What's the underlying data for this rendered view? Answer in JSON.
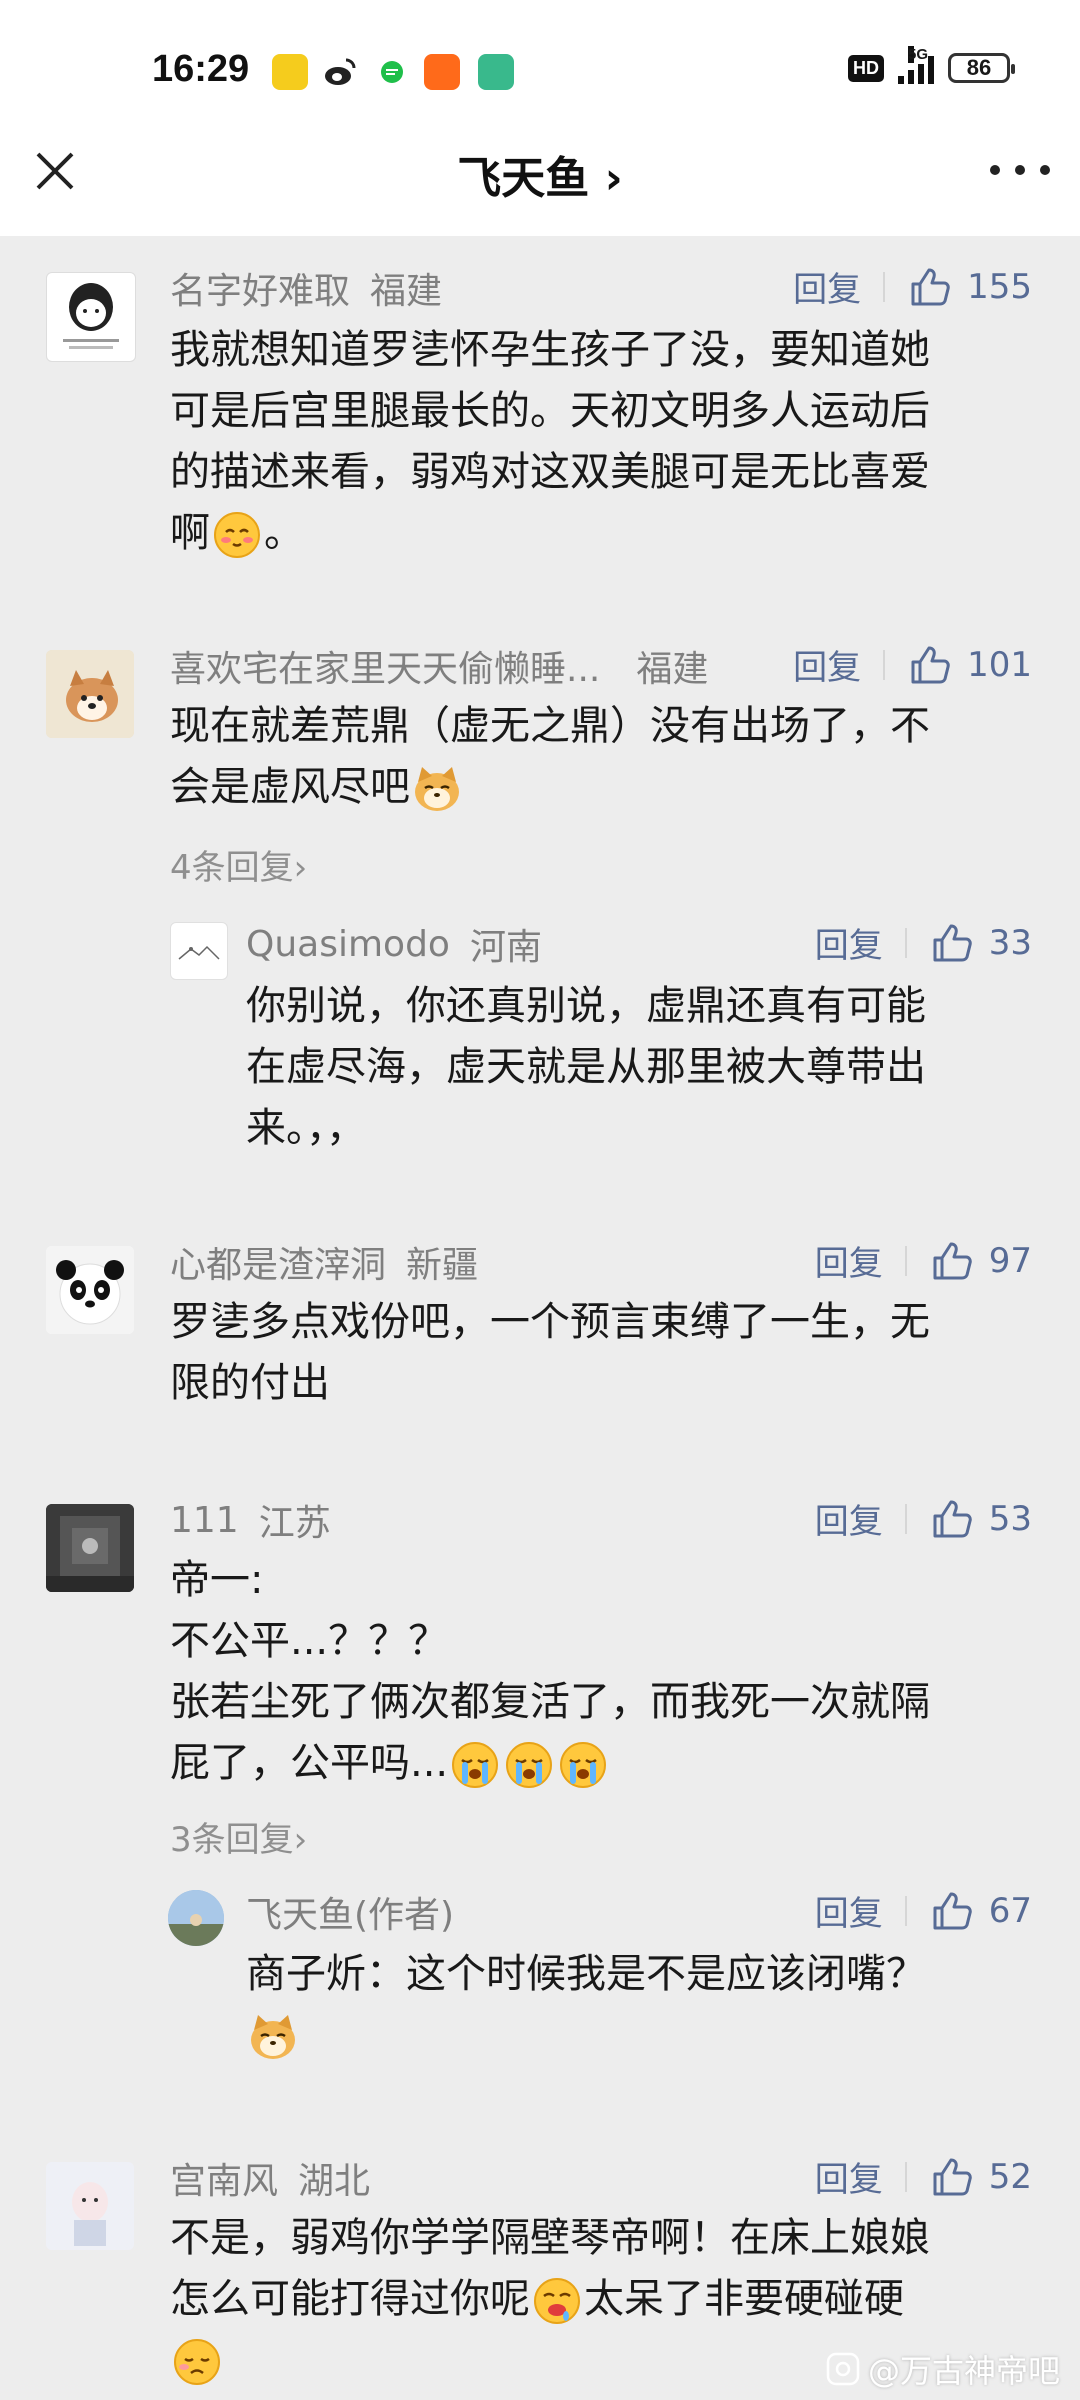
{
  "status_bar": {
    "time": "16:29",
    "network": "5G",
    "hd_label": "HD",
    "battery": "86"
  },
  "nav": {
    "title": "飞天鱼 ›"
  },
  "comments": [
    {
      "user": "名字好难取",
      "location": "福建",
      "reply_label": "回复",
      "likes": "155",
      "lines": [
        "我就想知道罗乼怀孕生孩子了没，要知道她",
        "可是后宫里腿最长的。天初文明多人运动后",
        "的描述来看，弱鸡对这双美腿可是无比喜爱",
        "啊",
        "。"
      ]
    },
    {
      "user": "喜欢宅在家里天天偷懒睡...",
      "location": "福建",
      "reply_label": "回复",
      "likes": "101",
      "lines": [
        "现在就差荒鼎（虚无之鼎）没有出场了，不",
        "会是虚风尽吧"
      ],
      "more_replies": "4条回复›",
      "reply": {
        "user": "Quasimodo",
        "location": "河南",
        "reply_label": "回复",
        "likes": "33",
        "lines": [
          "你别说，你还真别说，虚鼎还真有可能",
          "在虚尽海，虚天就是从那里被大尊带出",
          "来。，，"
        ]
      }
    },
    {
      "user": "心都是渣滓洞",
      "location": "新疆",
      "reply_label": "回复",
      "likes": "97",
      "lines": [
        "罗乼多点戏份吧，一个预言束缚了一生，无",
        "限的付出"
      ]
    },
    {
      "user": "111",
      "location": "江苏",
      "reply_label": "回复",
      "likes": "53",
      "lines": [
        "帝一:",
        "不公平...？？？",
        "张若尘死了俩次都复活了，而我死一次就隔",
        "屁了，公平吗..."
      ],
      "more_replies": "3条回复›",
      "reply": {
        "user": "飞天鱼(作者)",
        "location": "",
        "reply_label": "回复",
        "likes": "67",
        "lines": [
          "商子炘：这个时候我是不是应该闭嘴？"
        ]
      }
    },
    {
      "user": "宫南风",
      "location": "湖北",
      "reply_label": "回复",
      "likes": "52",
      "lines": [
        "不是，弱鸡你学学隔壁琴帝啊！在床上娘娘",
        "怎么可能打得过你呢",
        "太呆了非要硬碰硬"
      ]
    }
  ],
  "watermark": "@万古神帝吧",
  "colors": {
    "link": "#576b95",
    "meta": "#7f7f7f",
    "bg": "#ededed"
  }
}
